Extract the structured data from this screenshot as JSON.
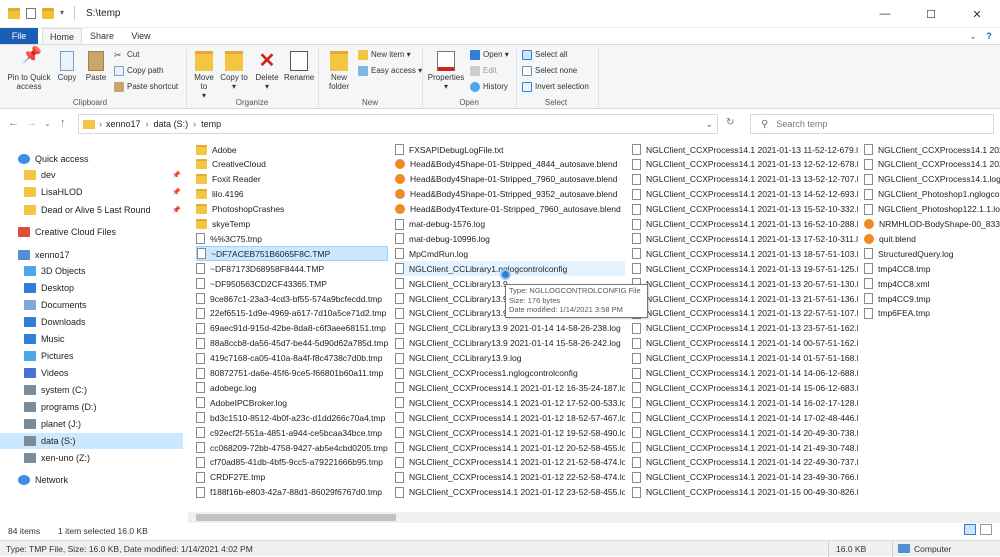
{
  "window": {
    "title": "S:\\temp",
    "minimize": "—",
    "maximize": "☐",
    "close": "✕"
  },
  "tabs": {
    "file": "File",
    "home": "Home",
    "share": "Share",
    "view": "View"
  },
  "ribbon": {
    "clipboard": {
      "pin": "Pin to Quick access",
      "copy": "Copy",
      "paste": "Paste",
      "cut": "Cut",
      "copy_path": "Copy path",
      "paste_shortcut": "Paste shortcut",
      "label": "Clipboard"
    },
    "organize": {
      "move_to": "Move to",
      "copy_to": "Copy to",
      "delete": "Delete",
      "rename": "Rename",
      "label": "Organize"
    },
    "new": {
      "new_folder": "New folder",
      "new_item": "New item",
      "easy_access": "Easy access",
      "label": "New"
    },
    "open": {
      "properties": "Properties",
      "open": "Open",
      "edit": "Edit",
      "history": "History",
      "label": "Open"
    },
    "select": {
      "select_all": "Select all",
      "select_none": "Select none",
      "invert": "Invert selection",
      "label": "Select"
    }
  },
  "address": {
    "path": [
      "xenno17",
      "data (S:)",
      "temp"
    ],
    "search_placeholder": "Search temp"
  },
  "nav": {
    "items": [
      {
        "label": "Quick access",
        "icon": "star-icon",
        "color": "#3c8ee7",
        "indent": 0,
        "pinned": false
      },
      {
        "label": "dev",
        "icon": "folder-icon",
        "color": "#f4c542",
        "indent": 1,
        "pinned": true
      },
      {
        "label": "LisaHLOD",
        "icon": "folder-icon",
        "color": "#f4c542",
        "indent": 1,
        "pinned": true
      },
      {
        "label": "Dead or Alive 5 Last Round",
        "icon": "folder-icon",
        "color": "#f4c542",
        "indent": 1,
        "pinned": true
      },
      {
        "label": "Creative Cloud Files",
        "icon": "cloud-icon",
        "color": "#d94f3a",
        "indent": 0,
        "pinned": false
      },
      {
        "label": "xenno17",
        "icon": "computer-icon",
        "color": "#4f8fd6",
        "indent": 0,
        "pinned": false
      },
      {
        "label": "3D Objects",
        "icon": "cube-icon",
        "color": "#4aa7e8",
        "indent": 1,
        "pinned": false
      },
      {
        "label": "Desktop",
        "icon": "desktop-icon",
        "color": "#2f7fd6",
        "indent": 1,
        "pinned": false
      },
      {
        "label": "Documents",
        "icon": "documents-icon",
        "color": "#7fa8d6",
        "indent": 1,
        "pinned": false
      },
      {
        "label": "Downloads",
        "icon": "download-icon",
        "color": "#2f7fd6",
        "indent": 1,
        "pinned": false
      },
      {
        "label": "Music",
        "icon": "music-icon",
        "color": "#2f7fd6",
        "indent": 1,
        "pinned": false
      },
      {
        "label": "Pictures",
        "icon": "pictures-icon",
        "color": "#4aa7e8",
        "indent": 1,
        "pinned": false
      },
      {
        "label": "Videos",
        "icon": "video-icon",
        "color": "#4a6fd6",
        "indent": 1,
        "pinned": false
      },
      {
        "label": "system (C:)",
        "icon": "drive-icon",
        "color": "#7a8c99",
        "indent": 1,
        "pinned": false
      },
      {
        "label": "programs (D:)",
        "icon": "drive-icon",
        "color": "#7a8c99",
        "indent": 1,
        "pinned": false
      },
      {
        "label": "planet (J:)",
        "icon": "drive-icon",
        "color": "#7a8c99",
        "indent": 1,
        "pinned": false
      },
      {
        "label": "data (S:)",
        "icon": "drive-icon",
        "color": "#7a8c99",
        "indent": 1,
        "pinned": false,
        "selected": true
      },
      {
        "label": "xen-uno (Z:)",
        "icon": "network-drive-icon",
        "color": "#7a8c99",
        "indent": 1,
        "pinned": false
      },
      {
        "label": "Network",
        "icon": "network-icon",
        "color": "#3c8ee7",
        "indent": 0,
        "pinned": false
      }
    ]
  },
  "files": {
    "columns": [
      [
        {
          "name": "Adobe",
          "type": "folder"
        },
        {
          "name": "CreativeCloud",
          "type": "folder"
        },
        {
          "name": "Foxit Reader",
          "type": "folder"
        },
        {
          "name": "lilo.4196",
          "type": "folder"
        },
        {
          "name": "PhotoshopCrashes",
          "type": "folder"
        },
        {
          "name": "skyeTemp",
          "type": "folder"
        },
        {
          "name": "%%3C75.tmp",
          "type": "doc"
        },
        {
          "name": "~DF7ACEB751B6065F8C.TMP",
          "type": "doc",
          "selected": true
        },
        {
          "name": "~DF87173D68958F8444.TMP",
          "type": "doc"
        },
        {
          "name": "~DF950563CD2CF43365.TMP",
          "type": "doc"
        },
        {
          "name": "9ce867c1-23a3-4cd3-bf55-574a9bcfecdd.tmp",
          "type": "doc"
        },
        {
          "name": "22ef6515-1d9e-4969-a617-7d10a5ce71d2.tmp",
          "type": "doc"
        },
        {
          "name": "69aec91d-915d-42be-8da8-c6f3aee68151.tmp",
          "type": "doc"
        },
        {
          "name": "88a8ccb8-da56-45d7-be44-5d90d62a785d.tmp",
          "type": "doc"
        },
        {
          "name": "419c7168-ca05-410a-8a4f-f8c4738c7d0b.tmp",
          "type": "doc"
        },
        {
          "name": "80872751-da6e-45f6-9ce5-f66801b60a11.tmp",
          "type": "doc"
        },
        {
          "name": "adobegc.log",
          "type": "doc"
        },
        {
          "name": "AdobeIPCBroker.log",
          "type": "doc"
        },
        {
          "name": "bd3c1510-8512-4b0f-a23c-d1dd266c70a4.tmp",
          "type": "doc"
        },
        {
          "name": "c92ecf2f-551a-4851-a944-ce5bcaa34bce.tmp",
          "type": "doc"
        },
        {
          "name": "cc068209-72bb-4758-9427-ab5e4cbd0205.tmp",
          "type": "doc"
        },
        {
          "name": "cf70ad85-41db-4bf5-9cc5-a79221666b95.tmp",
          "type": "doc"
        },
        {
          "name": "CRDF27E.tmp",
          "type": "doc"
        },
        {
          "name": "f188f16b-e803-42a7-88d1-86029f6767d0.tmp",
          "type": "doc"
        }
      ],
      [
        {
          "name": "FXSAPIDebugLogFile.txt",
          "type": "doc"
        },
        {
          "name": "Head&Body4Shape-01-Stripped_4844_autosave.blend",
          "type": "blend"
        },
        {
          "name": "Head&Body4Shape-01-Stripped_7960_autosave.blend",
          "type": "blend"
        },
        {
          "name": "Head&Body4Shape-01-Stripped_9352_autosave.blend",
          "type": "blend"
        },
        {
          "name": "Head&Body4Texture-01-Stripped_7960_autosave.blend",
          "type": "blend"
        },
        {
          "name": "mat-debug-1576.log",
          "type": "doc"
        },
        {
          "name": "mat-debug-10996.log",
          "type": "doc"
        },
        {
          "name": "MpCmdRun.log",
          "type": "doc"
        },
        {
          "name": "NGLClient_CCLibrary1.nglogcontrolconfig",
          "type": "doc",
          "hover": true
        },
        {
          "name": "NGLClient_CCLibrary13.9",
          "type": "doc"
        },
        {
          "name": "NGLClient_CCLibrary13.9",
          "type": "doc"
        },
        {
          "name": "NGLClient_CCLibrary13.9",
          "type": "doc"
        },
        {
          "name": "NGLClient_CCLibrary13.9 2021-01-14 14-58-26-238.log",
          "type": "doc"
        },
        {
          "name": "NGLClient_CCLibrary13.9 2021-01-14 15-58-26-242.log",
          "type": "doc"
        },
        {
          "name": "NGLClient_CCLibrary13.9.log",
          "type": "doc"
        },
        {
          "name": "NGLClient_CCXProcess1.nglogcontrolconfig",
          "type": "doc"
        },
        {
          "name": "NGLClient_CCXProcess14.1 2021-01-12 16-35-24-187.log",
          "type": "doc"
        },
        {
          "name": "NGLClient_CCXProcess14.1 2021-01-12 17-52-00-533.log",
          "type": "doc"
        },
        {
          "name": "NGLClient_CCXProcess14.1 2021-01-12 18-52-57-467.log",
          "type": "doc"
        },
        {
          "name": "NGLClient_CCXProcess14.1 2021-01-12 19-52-58-490.log",
          "type": "doc"
        },
        {
          "name": "NGLClient_CCXProcess14.1 2021-01-12 20-52-58-455.log",
          "type": "doc"
        },
        {
          "name": "NGLClient_CCXProcess14.1 2021-01-12 21-52-58-474.log",
          "type": "doc"
        },
        {
          "name": "NGLClient_CCXProcess14.1 2021-01-12 22-52-58-474.log",
          "type": "doc"
        },
        {
          "name": "NGLClient_CCXProcess14.1 2021-01-12 23-52-58-455.log",
          "type": "doc"
        }
      ],
      [
        {
          "name": "NGLClient_CCXProcess14.1 2021-01-13 11-52-12-679.log",
          "type": "doc"
        },
        {
          "name": "NGLClient_CCXProcess14.1 2021-01-13 12-52-12-678.log",
          "type": "doc"
        },
        {
          "name": "NGLClient_CCXProcess14.1 2021-01-13 13-52-12-707.log",
          "type": "doc"
        },
        {
          "name": "NGLClient_CCXProcess14.1 2021-01-13 14-52-12-693.log",
          "type": "doc"
        },
        {
          "name": "NGLClient_CCXProcess14.1 2021-01-13 15-52-10-332.log",
          "type": "doc"
        },
        {
          "name": "NGLClient_CCXProcess14.1 2021-01-13 16-52-10-288.log",
          "type": "doc"
        },
        {
          "name": "NGLClient_CCXProcess14.1 2021-01-13 17-52-10-311.log",
          "type": "doc"
        },
        {
          "name": "NGLClient_CCXProcess14.1 2021-01-13 18-57-51-103.log",
          "type": "doc"
        },
        {
          "name": "NGLClient_CCXProcess14.1 2021-01-13 19-57-51-125.log",
          "type": "doc"
        },
        {
          "name": "NGLClient_CCXProcess14.1 2021-01-13 20-57-51-130.log",
          "type": "doc"
        },
        {
          "name": "NGLClient_CCXProcess14.1 2021-01-13 21-57-51-136.log",
          "type": "doc"
        },
        {
          "name": "NGLClient_CCXProcess14.1 2021-01-13 22-57-51-107.log",
          "type": "doc"
        },
        {
          "name": "NGLClient_CCXProcess14.1 2021-01-13 23-57-51-162.log",
          "type": "doc"
        },
        {
          "name": "NGLClient_CCXProcess14.1 2021-01-14 00-57-51-162.log",
          "type": "doc"
        },
        {
          "name": "NGLClient_CCXProcess14.1 2021-01-14 01-57-51-168.log",
          "type": "doc"
        },
        {
          "name": "NGLClient_CCXProcess14.1 2021-01-14 14-06-12-688.log",
          "type": "doc"
        },
        {
          "name": "NGLClient_CCXProcess14.1 2021-01-14 15-06-12-683.log",
          "type": "doc"
        },
        {
          "name": "NGLClient_CCXProcess14.1 2021-01-14 16-02-17-128.log",
          "type": "doc"
        },
        {
          "name": "NGLClient_CCXProcess14.1 2021-01-14 17-02-48-446.log",
          "type": "doc"
        },
        {
          "name": "NGLClient_CCXProcess14.1 2021-01-14 20-49-30-738.log",
          "type": "doc"
        },
        {
          "name": "NGLClient_CCXProcess14.1 2021-01-14 21-49-30-748.log",
          "type": "doc"
        },
        {
          "name": "NGLClient_CCXProcess14.1 2021-01-14 22-49-30-737.log",
          "type": "doc"
        },
        {
          "name": "NGLClient_CCXProcess14.1 2021-01-14 23-49-30-766.log",
          "type": "doc"
        },
        {
          "name": "NGLClient_CCXProcess14.1 2021-01-15 00-49-30-826.log",
          "type": "doc"
        }
      ],
      [
        {
          "name": "NGLClient_CCXProcess14.1 2021-01-1",
          "type": "doc"
        },
        {
          "name": "NGLClient_CCXProcess14.1 2021-01-1",
          "type": "doc"
        },
        {
          "name": "NGLClient_CCXProcess14.1.log",
          "type": "doc"
        },
        {
          "name": "NGLClient_Photoshop1.nglogco",
          "type": "doc"
        },
        {
          "name": "NGLClient_Photoshop122.1.1.log",
          "type": "doc"
        },
        {
          "name": "NRMHLOD-BodyShape-00_8332",
          "type": "blend"
        },
        {
          "name": "quit.blend",
          "type": "blend"
        },
        {
          "name": "StructuredQuery.log",
          "type": "doc"
        },
        {
          "name": "tmp4CC8.tmp",
          "type": "doc"
        },
        {
          "name": "tmp4CC8.xml",
          "type": "doc"
        },
        {
          "name": "tmp4CC9.tmp",
          "type": "doc"
        },
        {
          "name": "tmp6FEA.tmp",
          "type": "doc"
        }
      ]
    ]
  },
  "tooltip": {
    "type": "Type: NGLLOGCONTROLCONFIG File",
    "size": "Size: 176 bytes",
    "date": "Date modified: 1/14/2021 3:58 PM"
  },
  "status": {
    "count": "84 items",
    "selected": "1 item selected  16.0 KB",
    "details": "Type: TMP File, Size: 16.0 KB, Date modified: 1/14/2021 4:02 PM",
    "size": "16.0 KB",
    "location": "Computer"
  }
}
